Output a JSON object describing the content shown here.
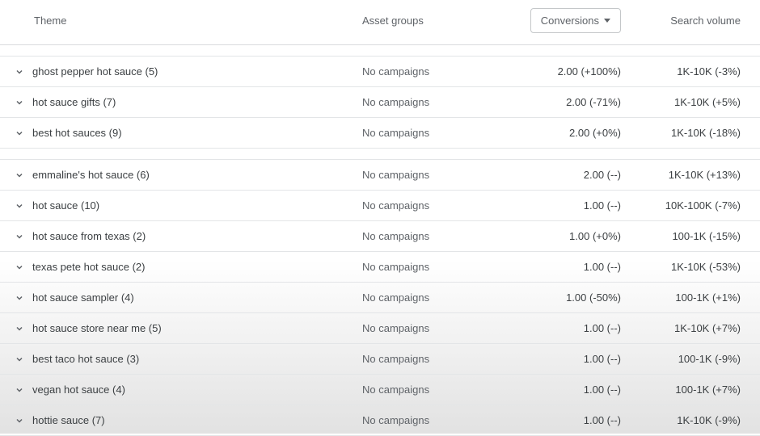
{
  "header": {
    "theme_label": "Theme",
    "asset_label": "Asset groups",
    "conversions_label": "Conversions",
    "search_label": "Search volume"
  },
  "rows": [
    {
      "theme": "ghost pepper hot sauce (5)",
      "asset": "No campaigns",
      "conversions": "2.00 (+100%)",
      "search": "1K-10K (-3%)"
    },
    {
      "theme": "hot sauce gifts (7)",
      "asset": "No campaigns",
      "conversions": "2.00 (-71%)",
      "search": "1K-10K (+5%)"
    },
    {
      "theme": "best hot sauces (9)",
      "asset": "No campaigns",
      "conversions": "2.00 (+0%)",
      "search": "1K-10K (-18%)"
    },
    {
      "gap": true
    },
    {
      "theme": "emmaline's hot sauce (6)",
      "asset": "No campaigns",
      "conversions": "2.00 (--)",
      "search": "1K-10K (+13%)"
    },
    {
      "theme": "hot sauce (10)",
      "asset": "No campaigns",
      "conversions": "1.00 (--)",
      "search": "10K-100K (-7%)"
    },
    {
      "theme": "hot sauce from texas (2)",
      "asset": "No campaigns",
      "conversions": "1.00 (+0%)",
      "search": "100-1K (-15%)"
    },
    {
      "theme": "texas pete hot sauce (2)",
      "asset": "No campaigns",
      "conversions": "1.00 (--)",
      "search": "1K-10K (-53%)"
    },
    {
      "theme": "hot sauce sampler (4)",
      "asset": "No campaigns",
      "conversions": "1.00 (-50%)",
      "search": "100-1K (+1%)"
    },
    {
      "theme": "hot sauce store near me (5)",
      "asset": "No campaigns",
      "conversions": "1.00 (--)",
      "search": "1K-10K (+7%)"
    },
    {
      "theme": "best taco hot sauce (3)",
      "asset": "No campaigns",
      "conversions": "1.00 (--)",
      "search": "100-1K (-9%)"
    },
    {
      "theme": "vegan hot sauce (4)",
      "asset": "No campaigns",
      "conversions": "1.00 (--)",
      "search": "100-1K (+7%)"
    },
    {
      "theme": "hottie sauce (7)",
      "asset": "No campaigns",
      "conversions": "1.00 (--)",
      "search": "1K-10K (-9%)"
    }
  ]
}
